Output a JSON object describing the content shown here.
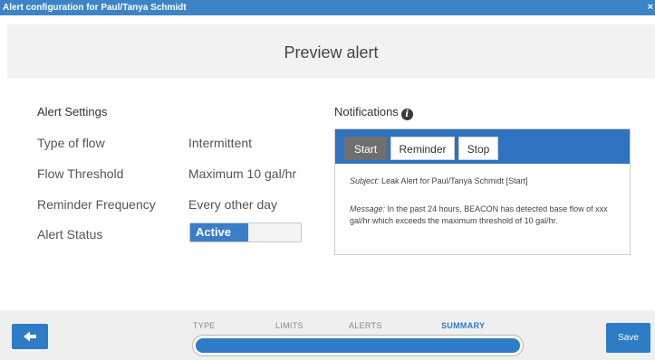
{
  "window": {
    "title": "Alert configuration for Paul/Tanya Schmidt",
    "close_glyph": "×"
  },
  "header": {
    "title": "Preview alert"
  },
  "alert_settings": {
    "title": "Alert Settings",
    "rows": [
      {
        "label": "Type of flow",
        "value": "Intermittent"
      },
      {
        "label": "Flow Threshold",
        "value": "Maximum 10 gal/hr"
      },
      {
        "label": "Reminder Frequency",
        "value": "Every other day"
      },
      {
        "label": "Alert Status",
        "value": "Active"
      }
    ]
  },
  "notifications": {
    "title": "Notifications",
    "info_icon": "info-icon",
    "tabs": [
      {
        "label": "Start",
        "active": true
      },
      {
        "label": "Reminder",
        "active": false
      },
      {
        "label": "Stop",
        "active": false
      }
    ],
    "subject_label": "Subject:",
    "subject_text": " Leak Alert for Paul/Tanya Schmidt [Start]",
    "message_label": "Message:",
    "message_text": " In the past 24 hours, BEACON has detected base flow of xxx gal/hr which exceeds the maximum threshold of 10 gal/hr."
  },
  "footer": {
    "back_icon": "arrow-left-icon",
    "save_label": "Save",
    "steps": [
      {
        "label": "TYPE",
        "current": false
      },
      {
        "label": "LIMITS",
        "current": false
      },
      {
        "label": "ALERTS",
        "current": false
      },
      {
        "label": "SUMMARY",
        "current": true
      }
    ],
    "progress": 1.0
  },
  "colors": {
    "accent": "#2e7cc6",
    "titlebar": "#3d84c6",
    "tabbar": "#2f72bf",
    "active_tab": "#6f6f6f"
  }
}
